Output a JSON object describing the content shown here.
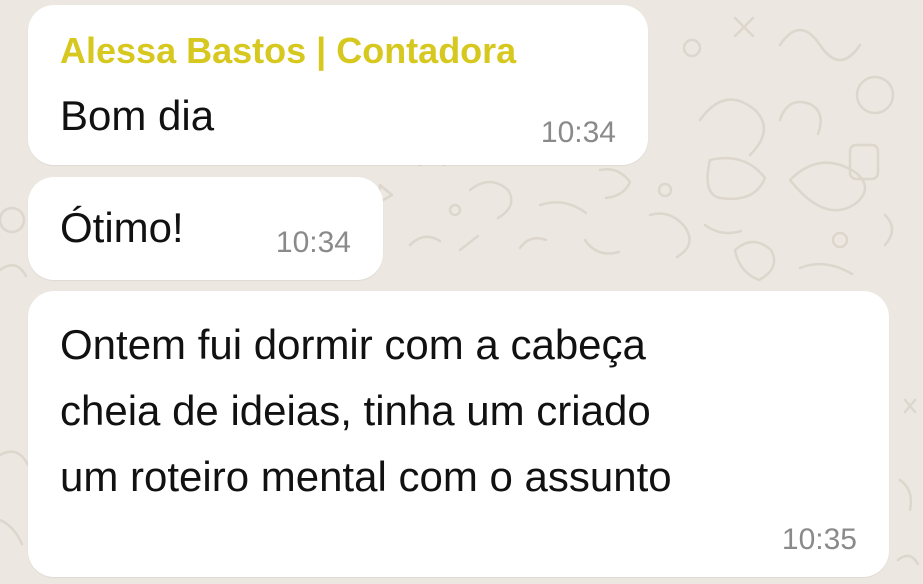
{
  "theme": {
    "sender_color": "#d6c81f",
    "bubble_color": "#ffffff",
    "wallpaper_color": "#ece7e0",
    "time_color": "#8a8a8a"
  },
  "messages": [
    {
      "sender": "Alessa Bastos | Contadora",
      "text": "Bom dia",
      "time": "10:34"
    },
    {
      "text": "Ótimo!",
      "time": "10:34"
    },
    {
      "text_lines": [
        "Ontem fui dormir com a cabeça",
        "cheia de ideias, tinha um criado",
        "um roteiro mental com o assunto"
      ],
      "time": "10:35"
    }
  ]
}
